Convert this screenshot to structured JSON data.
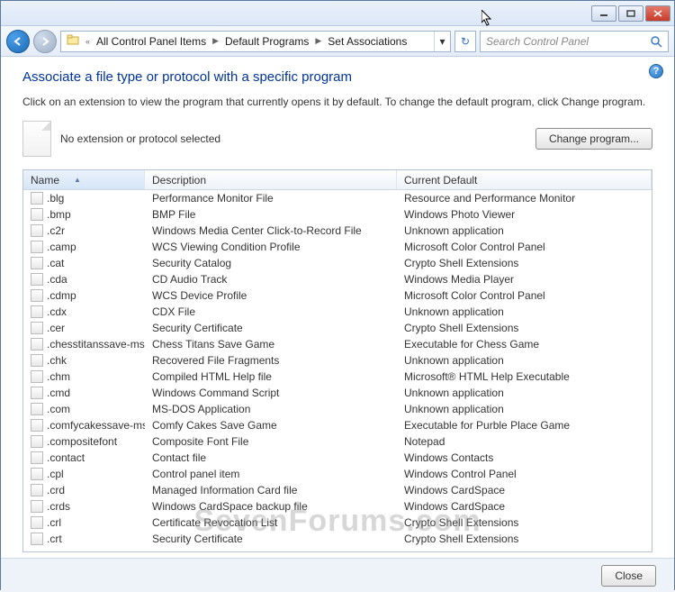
{
  "breadcrumb": {
    "prefix": "«",
    "items": [
      "All Control Panel Items",
      "Default Programs",
      "Set Associations"
    ]
  },
  "search": {
    "placeholder": "Search Control Panel"
  },
  "page": {
    "title": "Associate a file type or protocol with a specific program",
    "subtitle": "Click on an extension to view the program that currently opens it by default. To change the default program, click Change program.",
    "no_extension": "No extension or protocol selected",
    "change_btn": "Change program...",
    "close_btn": "Close"
  },
  "columns": {
    "name": "Name",
    "desc": "Description",
    "def": "Current Default"
  },
  "rows": [
    {
      "name": ".blg",
      "desc": "Performance Monitor File",
      "def": "Resource and Performance Monitor"
    },
    {
      "name": ".bmp",
      "desc": "BMP File",
      "def": "Windows Photo Viewer"
    },
    {
      "name": ".c2r",
      "desc": "Windows Media Center Click-to-Record File",
      "def": "Unknown application"
    },
    {
      "name": ".camp",
      "desc": "WCS Viewing Condition Profile",
      "def": "Microsoft Color Control Panel"
    },
    {
      "name": ".cat",
      "desc": "Security Catalog",
      "def": "Crypto Shell Extensions"
    },
    {
      "name": ".cda",
      "desc": "CD Audio Track",
      "def": "Windows Media Player"
    },
    {
      "name": ".cdmp",
      "desc": "WCS Device Profile",
      "def": "Microsoft Color Control Panel"
    },
    {
      "name": ".cdx",
      "desc": "CDX File",
      "def": "Unknown application"
    },
    {
      "name": ".cer",
      "desc": "Security Certificate",
      "def": "Crypto Shell Extensions"
    },
    {
      "name": ".chesstitanssave-ms",
      "desc": "Chess Titans Save Game",
      "def": "Executable for Chess Game"
    },
    {
      "name": ".chk",
      "desc": "Recovered File Fragments",
      "def": "Unknown application"
    },
    {
      "name": ".chm",
      "desc": "Compiled HTML Help file",
      "def": "Microsoft® HTML Help Executable"
    },
    {
      "name": ".cmd",
      "desc": "Windows Command Script",
      "def": "Unknown application"
    },
    {
      "name": ".com",
      "desc": "MS-DOS Application",
      "def": "Unknown application"
    },
    {
      "name": ".comfycakessave-ms",
      "desc": "Comfy Cakes Save Game",
      "def": "Executable for Purble Place Game"
    },
    {
      "name": ".compositefont",
      "desc": "Composite Font File",
      "def": "Notepad"
    },
    {
      "name": ".contact",
      "desc": "Contact file",
      "def": "Windows Contacts"
    },
    {
      "name": ".cpl",
      "desc": "Control panel item",
      "def": "Windows Control Panel"
    },
    {
      "name": ".crd",
      "desc": "Managed Information Card file",
      "def": "Windows CardSpace"
    },
    {
      "name": ".crds",
      "desc": "Windows CardSpace backup file",
      "def": "Windows CardSpace"
    },
    {
      "name": ".crl",
      "desc": "Certificate Revocation List",
      "def": "Crypto Shell Extensions"
    },
    {
      "name": ".crt",
      "desc": "Security Certificate",
      "def": "Crypto Shell Extensions"
    }
  ],
  "watermark": "SevenForums.com"
}
